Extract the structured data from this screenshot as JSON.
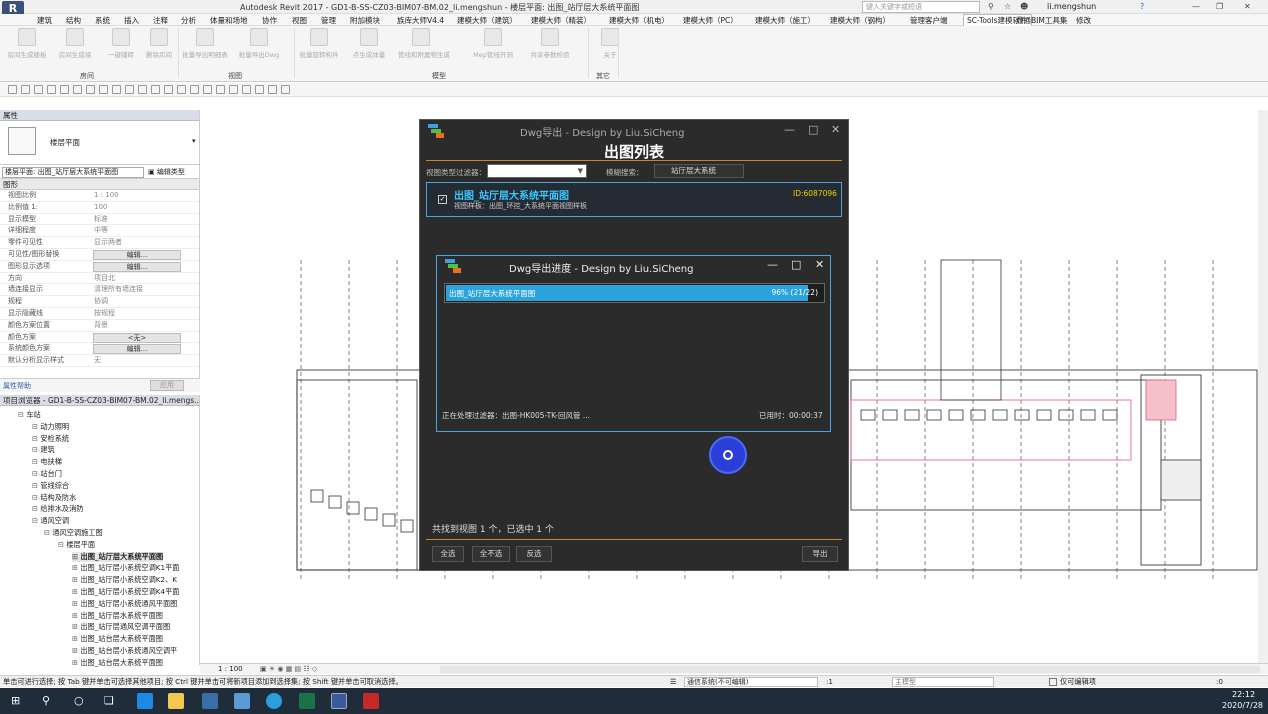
{
  "window": {
    "title": "Autodesk Revit 2017 -    GD1-B-SS-CZ03-BIM07-BM.02_li.mengshun - 楼层平面: 出图_站厅层大系统平面图",
    "search_placeholder": "键入关键字或短语",
    "user": "li.mengshun",
    "app_letter": "R"
  },
  "menu": [
    "建筑",
    "结构",
    "系统",
    "插入",
    "注释",
    "分析",
    "体量和场地",
    "协作",
    "视图",
    "管理",
    "附加模块",
    "族库大师V4.4",
    "建模大师（建筑）",
    "建模大师（精装）",
    "建模大师（机电）",
    "建模大师（PC）",
    "建模大师（施工）",
    "建模大师（钢构）",
    "管理客户端",
    "SC-Tools建模软件",
    "鼎通BIM工具集",
    "修改"
  ],
  "ribbon": {
    "buttons": [
      "房间生成楼板",
      "房间生成墙",
      "一键铺砖",
      "删除房间",
      "批量导出明细表",
      "批量导出Dwg",
      "批量旋转构件",
      "点生成体量",
      "管线和附属物生成",
      "Mep管线开洞",
      "共享参数检验",
      "关于"
    ],
    "groups": [
      "房间",
      "视图",
      "模型",
      "其它"
    ]
  },
  "properties": {
    "header": "属性",
    "type_name": "楼层平面",
    "selector": "楼层平面: 出图_站厅层大系统平面图",
    "edit_type": "编辑类型",
    "section": "图形",
    "rows": [
      {
        "k": "视图比例",
        "v": "1 : 100"
      },
      {
        "k": "比例值 1:",
        "v": "100"
      },
      {
        "k": "显示模型",
        "v": "标准"
      },
      {
        "k": "详细程度",
        "v": "中等"
      },
      {
        "k": "零件可见性",
        "v": "显示两者"
      },
      {
        "k": "可见性/图形替换",
        "b": "编辑..."
      },
      {
        "k": "图形显示选项",
        "b": "编辑..."
      },
      {
        "k": "方向",
        "v": "项目北"
      },
      {
        "k": "墙连接显示",
        "v": "清理所有墙连接"
      },
      {
        "k": "规程",
        "v": "协调"
      },
      {
        "k": "显示隐藏线",
        "v": "按规程"
      },
      {
        "k": "颜色方案位置",
        "v": "背景"
      },
      {
        "k": "颜色方案",
        "b": "<无>"
      },
      {
        "k": "系统颜色方案",
        "b": "编辑..."
      },
      {
        "k": "默认分析显示样式",
        "v": "无"
      }
    ],
    "help": "属性帮助",
    "apply": "应用"
  },
  "browser": {
    "header": "项目浏览器 - GD1-B-SS-CZ03-BIM07-BM.02_li.mengs...",
    "items": [
      "车站",
      "动力照明",
      "安检系统",
      "建筑",
      "电扶梯",
      "站台门",
      "管线综合",
      "结构及防水",
      "给排水及消防",
      "通风空调",
      "通风空调施工图",
      "楼层平面",
      "出图_站厅层大系统平面图",
      "出图_站厅层小系统空调K1平面",
      "出图_站厅层小系统空调K2、K",
      "出图_站厅层小系统空调K4平面",
      "出图_站厅层小系统通风平面图",
      "出图_站厅层水系统平面图",
      "出图_站厅层通风空调平面图",
      "出图_站台层大系统平面图",
      "出图_站台层小系统通风空调平",
      "出图_站台层大系统平面图"
    ]
  },
  "dlg_export": {
    "title": "Dwg导出   -   Design by Liu.SiCheng",
    "heading": "出图列表",
    "filter_label": "视图类型过滤器：",
    "fuzzy_label": "模糊搜索：",
    "fuzzy_value": "站厅层大系统",
    "item_title": "出图_站厅层大系统平面图",
    "item_sub": "视图样板：出图_环控_大系统平面视图样板",
    "item_id": "ID:6087096",
    "summary": "共找到视图 1 个，已选中 1 个",
    "btn_all": "全选",
    "btn_none": "全不选",
    "btn_invert": "反选",
    "btn_export": "导出"
  },
  "dlg_progress": {
    "title": "Dwg导出进度   -   Design by Liu.SiCheng",
    "bar_label": "出图_站厅层大系统平面图",
    "bar_text": "96% (21/22)",
    "progress": 0.96,
    "status": "正在处理过滤器：出图-HK005-TK-回风管 ...",
    "elapsed": "已用时：00:00:37"
  },
  "view_scale": "1 : 100",
  "status": {
    "hint": "单击可进行选择; 按 Tab 键并单击可选择其他项目; 按 Ctrl 键并单击可将新项目添加到选择集; 按 Shift 键并单击可取消选择。",
    "workset": "通信系统(不可编辑)",
    "zero": ":1",
    "model": "主模型",
    "editable_only": "仅可编辑项",
    "filter_count": ":0"
  },
  "clock": {
    "time": "22:12",
    "date": "2020/7/28"
  },
  "colors": {
    "accent": "#2d9fd8",
    "progress": "#2aa3dc",
    "busy": "#2a3fd8",
    "dialog_bg": "#2b2b2b",
    "cyan_text": "#3ac8ff",
    "id_text": "#f0d000"
  }
}
